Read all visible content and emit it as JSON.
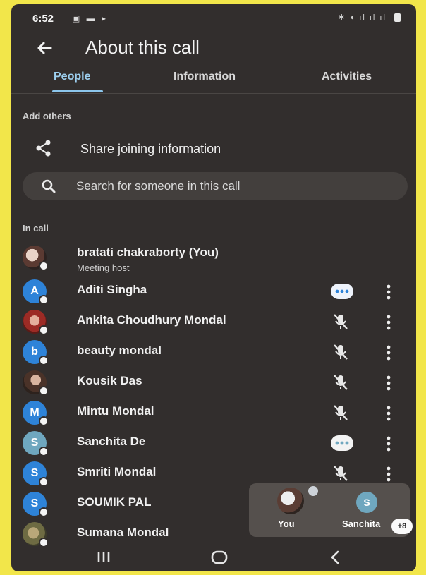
{
  "status": {
    "time": "6:52",
    "left_icons": "▣ ▬ ▸",
    "right_icons": "✱ ◖ ıl ıl ıl"
  },
  "header": {
    "title": "About this call"
  },
  "tabs": [
    {
      "label": "People",
      "active": true
    },
    {
      "label": "Information",
      "active": false
    },
    {
      "label": "Activities",
      "active": false
    }
  ],
  "add_others": {
    "section_label": "Add others",
    "share_label": "Share joining information",
    "search_placeholder": "Search for someone in this call"
  },
  "in_call": {
    "section_label": "In call",
    "participants": [
      {
        "name": "bratati chakraborty (You)",
        "subtitle": "Meeting host",
        "avatar": "photo",
        "status_icon": "none"
      },
      {
        "name": "Aditi Singha",
        "initial": "A",
        "avatar_color": "#2e83d8",
        "status_icon": "more-horiz-bubble-icon"
      },
      {
        "name": "Ankita Choudhury Mondal",
        "avatar": "photo",
        "status_icon": "mic-off-icon"
      },
      {
        "name": "beauty mondal",
        "initial": "b",
        "avatar_color": "#2e83d8",
        "status_icon": "mic-off-icon"
      },
      {
        "name": "Kousik Das",
        "avatar": "photo",
        "status_icon": "mic-off-icon"
      },
      {
        "name": "Mintu Mondal",
        "initial": "M",
        "avatar_color": "#2e83d8",
        "status_icon": "mic-off-icon"
      },
      {
        "name": "Sanchita De",
        "initial": "S",
        "avatar_color": "#6fa7bf",
        "status_icon": "more-horiz-bubble-icon"
      },
      {
        "name": "Smriti Mondal",
        "initial": "S",
        "avatar_color": "#2e83d8",
        "status_icon": "mic-off-icon"
      },
      {
        "name": "SOUMIK PAL",
        "initial": "S",
        "avatar_color": "#2e83d8",
        "status_icon": "none"
      },
      {
        "name": "Sumana Mondal",
        "avatar": "photo",
        "status_icon": "none"
      }
    ]
  },
  "pip": {
    "you_label": "You",
    "other_label": "Sanchita",
    "other_initial": "S",
    "more_count": "+8"
  },
  "colors": {
    "accent": "#8cc6ec",
    "background": "#322e2d",
    "avatar_blue": "#2e83d8",
    "avatar_teal": "#6fa7bf"
  }
}
